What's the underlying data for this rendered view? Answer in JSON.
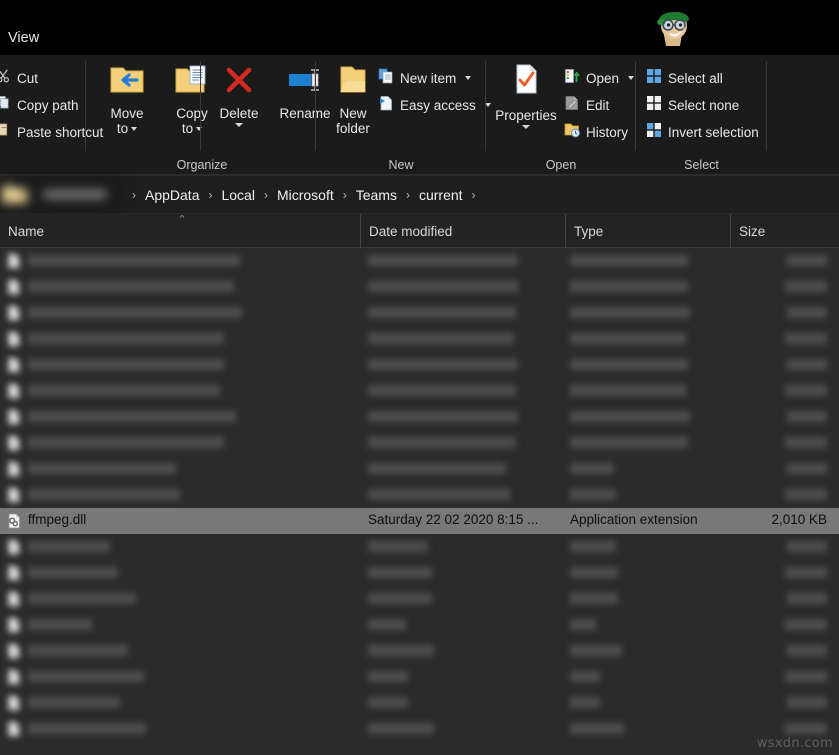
{
  "window": {
    "active_tab": "View",
    "mascot_icon": "cartoon-face-green-hat-icon",
    "watermark": "wsxdn.com"
  },
  "ribbon": {
    "clipboard_group": {
      "items": [
        {
          "label": "Cut",
          "icon": "scissors-icon"
        },
        {
          "label": "Copy path",
          "icon": "copy-path-icon"
        },
        {
          "label": "Paste shortcut",
          "icon": "paste-shortcut-icon"
        }
      ]
    },
    "organize_group": {
      "title": "Organize",
      "items": [
        {
          "label": "Move\nto",
          "label_line1": "Move",
          "label_line2": "to",
          "icon": "move-to-icon",
          "has_caret": true
        },
        {
          "label": "Copy\nto",
          "label_line1": "Copy",
          "label_line2": "to",
          "icon": "copy-to-icon",
          "has_caret": true
        },
        {
          "label": "Delete",
          "icon": "delete-x-icon",
          "has_caret": true
        },
        {
          "label": "Rename",
          "icon": "rename-icon",
          "has_caret": false
        }
      ]
    },
    "new_group": {
      "title": "New",
      "big_item": {
        "label_line1": "New",
        "label_line2": "folder",
        "icon": "new-folder-icon"
      },
      "items": [
        {
          "label": "New item",
          "icon": "new-item-icon",
          "has_caret": true
        },
        {
          "label": "Easy access",
          "icon": "easy-access-icon",
          "has_caret": true
        }
      ]
    },
    "open_group": {
      "title": "Open",
      "big_item": {
        "label": "Properties",
        "icon": "properties-icon",
        "has_caret": true
      },
      "items": [
        {
          "label": "Open",
          "icon": "open-icon",
          "has_caret": true
        },
        {
          "label": "Edit",
          "icon": "edit-icon",
          "has_caret": false
        },
        {
          "label": "History",
          "icon": "history-icon",
          "has_caret": false
        }
      ]
    },
    "select_group": {
      "title": "Select",
      "items": [
        {
          "label": "Select all",
          "icon": "select-all-icon"
        },
        {
          "label": "Select none",
          "icon": "select-none-icon"
        },
        {
          "label": "Invert selection",
          "icon": "invert-selection-icon"
        }
      ]
    }
  },
  "address_bar": {
    "redacted_prefix": "",
    "crumbs": [
      "AppData",
      "Local",
      "Microsoft",
      "Teams",
      "current"
    ],
    "chevron": "›"
  },
  "columns": [
    {
      "key": "name",
      "label": "Name",
      "sorted": true,
      "sort_direction": "ascending",
      "sort_glyph": "⌃"
    },
    {
      "key": "date",
      "label": "Date modified"
    },
    {
      "key": "type",
      "label": "Type"
    },
    {
      "key": "size",
      "label": "Size"
    }
  ],
  "files": {
    "selected_index": 10,
    "rows": [
      {
        "name": "",
        "date": "",
        "type": "",
        "size": "",
        "redacted": true,
        "icon": "file-icon"
      },
      {
        "name": "",
        "date": "",
        "type": "",
        "size": "",
        "redacted": true,
        "icon": "file-icon"
      },
      {
        "name": "",
        "date": "",
        "type": "",
        "size": "",
        "redacted": true,
        "icon": "file-icon"
      },
      {
        "name": "",
        "date": "",
        "type": "",
        "size": "",
        "redacted": true,
        "icon": "file-icon"
      },
      {
        "name": "",
        "date": "",
        "type": "",
        "size": "",
        "redacted": true,
        "icon": "file-icon"
      },
      {
        "name": "",
        "date": "",
        "type": "",
        "size": "",
        "redacted": true,
        "icon": "file-icon"
      },
      {
        "name": "",
        "date": "",
        "type": "",
        "size": "",
        "redacted": true,
        "icon": "file-icon"
      },
      {
        "name": "",
        "date": "",
        "type": "",
        "size": "",
        "redacted": true,
        "icon": "file-icon"
      },
      {
        "name": "",
        "date": "",
        "type": "",
        "size": "",
        "redacted": true,
        "icon": "file-icon"
      },
      {
        "name": "",
        "date": "",
        "type": "",
        "size": "",
        "redacted": true,
        "icon": "file-icon"
      },
      {
        "name": "ffmpeg.dll",
        "date": "Saturday 22 02 2020 8:15 ...",
        "type": "Application extension",
        "size": "2,010 KB",
        "redacted": false,
        "icon": "dll-file-icon"
      },
      {
        "name": "",
        "date": "",
        "type": "",
        "size": "",
        "redacted": true,
        "icon": "file-icon"
      },
      {
        "name": "",
        "date": "",
        "type": "",
        "size": "",
        "redacted": true,
        "icon": "file-icon"
      },
      {
        "name": "",
        "date": "",
        "type": "",
        "size": "",
        "redacted": true,
        "icon": "file-icon"
      },
      {
        "name": "",
        "date": "",
        "type": "",
        "size": "",
        "redacted": true,
        "icon": "file-icon"
      },
      {
        "name": "",
        "date": "",
        "type": "",
        "size": "",
        "redacted": true,
        "icon": "file-icon"
      },
      {
        "name": "",
        "date": "",
        "type": "",
        "size": "",
        "redacted": true,
        "icon": "file-icon"
      },
      {
        "name": "",
        "date": "",
        "type": "",
        "size": "",
        "redacted": true,
        "icon": "file-icon"
      },
      {
        "name": "",
        "date": "",
        "type": "",
        "size": "",
        "redacted": true,
        "icon": "file-icon"
      }
    ]
  },
  "colors": {
    "window_bg": "#000000",
    "ribbon_bg": "#1b1b1b",
    "list_bg": "#2b2b2b",
    "selection_bg": "#787878",
    "text": "#e8e8e8",
    "accent_blue": "#4a9fe0",
    "delete_red": "#d32020",
    "folder_yellow": "#f2cc69"
  }
}
